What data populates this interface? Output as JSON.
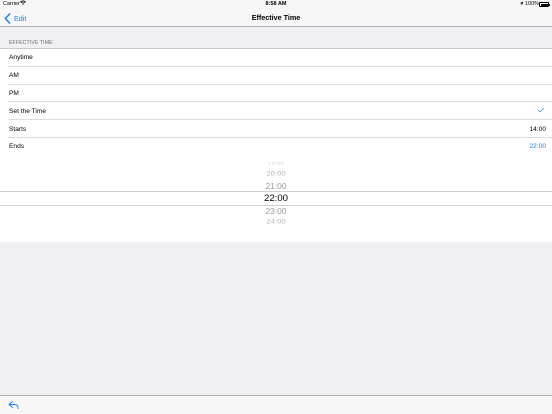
{
  "status_bar": {
    "carrier": "Carrier",
    "wifi_icon": "wifi-icon",
    "time": "8:58 AM",
    "location_icon": "location-arrow-icon",
    "battery_percent": "100%",
    "battery_icon": "battery-full-icon"
  },
  "nav": {
    "back_label": "Edit",
    "back_icon": "chevron-left-icon",
    "title": "Effective Time"
  },
  "section": {
    "header": "EFFECTIVE TIME"
  },
  "rows": [
    {
      "label": "Anytime",
      "value": "",
      "checked": false
    },
    {
      "label": "AM",
      "value": "",
      "checked": false
    },
    {
      "label": "PM",
      "value": "",
      "checked": false
    },
    {
      "label": "Set the Time",
      "value": "",
      "checked": true
    },
    {
      "label": "Starts",
      "value": "14:00",
      "active": false
    },
    {
      "label": "Ends",
      "value": "22:00",
      "active": true
    }
  ],
  "picker": {
    "items": [
      "19:00",
      "20:00",
      "21:00",
      "22:00",
      "23:00",
      "24:00"
    ],
    "selected": "22:00"
  },
  "toolbar": {
    "share_icon": "share-arrow-icon"
  },
  "colors": {
    "accent": "#1a7ff2",
    "background": "#efeff4",
    "bar": "#f7f7f7"
  }
}
